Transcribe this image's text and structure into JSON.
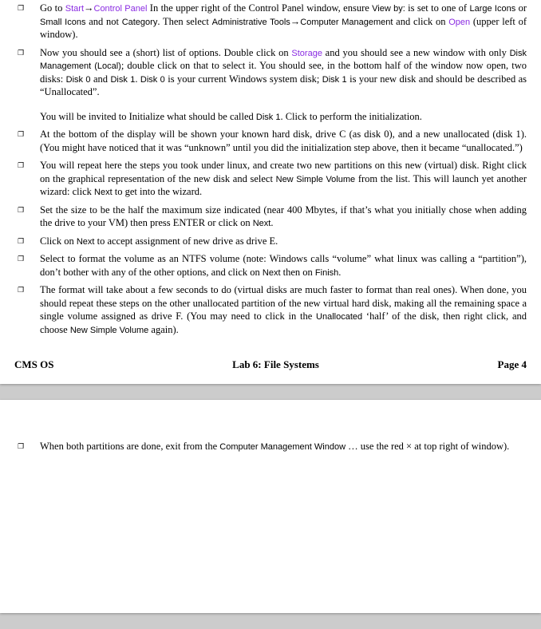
{
  "page1": {
    "items": [
      {
        "marker": "❐",
        "paragraphs": [
          {
            "segments": [
              {
                "text": "Go to "
              },
              {
                "text": "Start",
                "class": "link ui-text"
              },
              {
                "text": " → ",
                "class": "arrow"
              },
              {
                "text": "Control Panel",
                "class": "link ui-text"
              },
              {
                "text": " In the upper right of the Control Panel window, ensure "
              },
              {
                "text": "View by:",
                "class": "ui-text"
              },
              {
                "text": " is set to one of "
              },
              {
                "text": "Large Icons",
                "class": "ui-text"
              },
              {
                "text": " or "
              },
              {
                "text": "Small Icons",
                "class": "ui-text"
              },
              {
                "text": " and not "
              },
              {
                "text": "Category",
                "class": "ui-text"
              },
              {
                "text": ". Then select "
              },
              {
                "text": "Administrative Tools",
                "class": "ui-text"
              },
              {
                "text": " → ",
                "class": "arrow"
              },
              {
                "text": "Computer Management",
                "class": "ui-text"
              },
              {
                "text": " and click on "
              },
              {
                "text": "Open",
                "class": "link ui-text"
              },
              {
                "text": " (upper left of window)."
              }
            ]
          }
        ]
      },
      {
        "marker": "❐",
        "paragraphs": [
          {
            "segments": [
              {
                "text": "Now you should see a (short) list of options. Double click on "
              },
              {
                "text": "Storage",
                "class": "link ui-text"
              },
              {
                "text": " and you should see a new window with only "
              },
              {
                "text": "Disk Management (Local)",
                "class": "ui-text"
              },
              {
                "text": "; double click on that to select it. You should see, in the bottom half of the window now open, two disks: "
              },
              {
                "text": "Disk 0",
                "class": "ui-text"
              },
              {
                "text": " and "
              },
              {
                "text": "Disk 1",
                "class": "ui-text"
              },
              {
                "text": ". "
              },
              {
                "text": "Disk 0",
                "class": "ui-text"
              },
              {
                "text": " is your current Windows system disk; "
              },
              {
                "text": "Disk 1",
                "class": "ui-text"
              },
              {
                "text": " is your new disk and should be described as “Unallocated”."
              }
            ]
          },
          {
            "segments": [
              {
                "text": "You will be invited to Initialize what should be called "
              },
              {
                "text": "Disk 1",
                "class": "ui-text"
              },
              {
                "text": ". Click to perform the initialization."
              }
            ],
            "gapBefore": true
          }
        ]
      },
      {
        "marker": "❐",
        "paragraphs": [
          {
            "segments": [
              {
                "text": "At the bottom of the display will be shown your known hard disk, drive C (as disk 0), and a new unallocated (disk 1). (You might have noticed that it was “unknown” until you did the initialization step above, then it became “unallocated.”)"
              }
            ]
          }
        ]
      },
      {
        "marker": "❐",
        "paragraphs": [
          {
            "segments": [
              {
                "text": "You will repeat here the steps you took under linux, and create two new partitions on this new (virtual) disk. Right click on the graphical representation of the new disk and select "
              },
              {
                "text": "New Simple Volume",
                "class": "ui-text"
              },
              {
                "text": " from the list. This will launch yet another wizard: click "
              },
              {
                "text": "Next",
                "class": "ui-text"
              },
              {
                "text": " to get into the wizard."
              }
            ]
          }
        ]
      },
      {
        "marker": "❐",
        "paragraphs": [
          {
            "segments": [
              {
                "text": "Set the size to be the half the maximum size indicated (near 400 Mbytes, if that’s what you initially chose when adding the drive to your VM) then press ENTER or click on "
              },
              {
                "text": "Next",
                "class": "ui-text"
              },
              {
                "text": "."
              }
            ]
          }
        ]
      },
      {
        "marker": "❐",
        "paragraphs": [
          {
            "segments": [
              {
                "text": "Click on "
              },
              {
                "text": "Next",
                "class": "ui-text"
              },
              {
                "text": " to accept assignment of new drive as drive E."
              }
            ]
          }
        ]
      },
      {
        "marker": "❐",
        "paragraphs": [
          {
            "segments": [
              {
                "text": "Select to format the volume as an NTFS volume (note: Windows calls “volume” what linux was calling a “partition”), don’t bother with any of the other options, and click on "
              },
              {
                "text": "Next",
                "class": "ui-text"
              },
              {
                "text": " then on "
              },
              {
                "text": "Finish",
                "class": "ui-text"
              },
              {
                "text": "."
              }
            ]
          }
        ]
      },
      {
        "marker": "❐",
        "paragraphs": [
          {
            "segments": [
              {
                "text": "The format will take about a few seconds to do (virtual disks are much faster to format than real ones). When done, you should repeat these steps on the other unallocated partition of the new virtual hard disk, making all the remaining space a single volume assigned as drive F. (You may need to click in the "
              },
              {
                "text": "Unallocated",
                "class": "ui-text"
              },
              {
                "text": " ‘half’ of the disk, then right click, and choose "
              },
              {
                "text": "New Simple Volume",
                "class": "ui-text"
              },
              {
                "text": " again)."
              }
            ]
          }
        ]
      }
    ],
    "footer": {
      "left": "CMS OS",
      "center": "Lab 6: File Systems",
      "right": "Page 4"
    }
  },
  "page2": {
    "items": [
      {
        "marker": "❐",
        "paragraphs": [
          {
            "segments": [
              {
                "text": "When both partitions are done, exit from the "
              },
              {
                "text": "Computer Management Window",
                "class": "ui-text"
              },
              {
                "text": " … use the red × at top right of window)."
              }
            ]
          }
        ]
      }
    ]
  }
}
